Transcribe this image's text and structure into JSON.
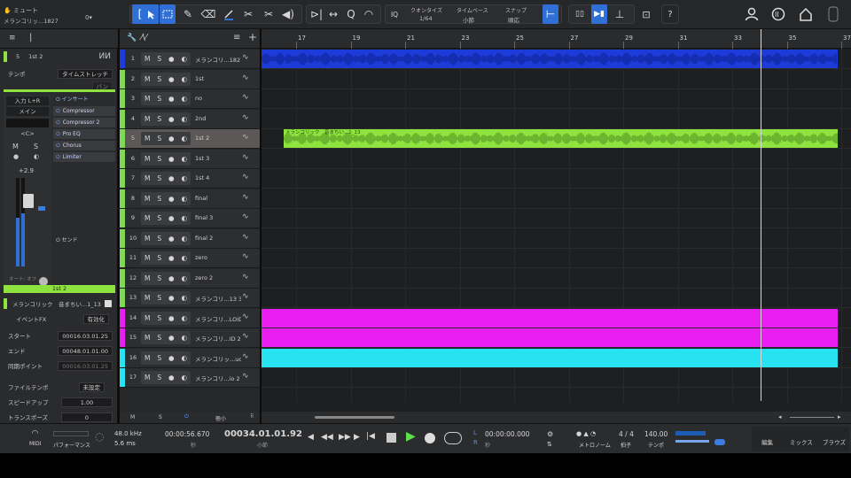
{
  "song": {
    "title": "ミュート",
    "file": "メランコリッ...1827",
    "dropdown": "0▾"
  },
  "toolbar": {
    "quantize_label": "クオンタイズ",
    "quantize_value": "1/64",
    "timebase_label": "タイムベース",
    "timebase_value": "小節",
    "snap_label": "スナップ",
    "snap_value": "順応",
    "iq": "IQ",
    "help": "?"
  },
  "inspector": {
    "track_num": "5",
    "track_name": "1st 2",
    "tempo_label": "テンポ",
    "tempo_value": "タイムストレッチ",
    "tempo2_value": "パン",
    "io_label": "入力 L+R",
    "io_main": "メイン",
    "pan": "<C>",
    "volume": "+2.9",
    "bottom_num": "5",
    "auto": "オート: オフ",
    "inserts_title": "インサート",
    "plugins": [
      "Compressor",
      "Compressor 2",
      "Pro EQ",
      "Chorus",
      "Limiter"
    ],
    "sends_title": "センド",
    "channel_name": "1st 2",
    "event_title": "メランコリック　音まちい...1_13",
    "event_fx": "イベントFX",
    "event_fx_val": "有効化",
    "start_label": "スタート",
    "start_val": "00016.03.01.25",
    "end_label": "エンド",
    "end_val": "00048.01.01.00",
    "sync_label": "同期ポイント",
    "sync_val": "00016.03.01.25",
    "file_tempo_label": "ファイルテンポ",
    "file_tempo_val": "未設定",
    "speed_label": "スピードアップ",
    "speed_val": "1.00",
    "transpose_label": "トランスポーズ",
    "transpose_val": "0"
  },
  "tracks": [
    {
      "num": "1",
      "name": "メランコリ...1827",
      "color": "#1d3bd8"
    },
    {
      "num": "2",
      "name": "1st",
      "color": "#7ed957"
    },
    {
      "num": "3",
      "name": "no",
      "color": "#7ed957"
    },
    {
      "num": "4",
      "name": "2nd",
      "color": "#7ed957"
    },
    {
      "num": "5",
      "name": "1st 2",
      "color": "#7ed957"
    },
    {
      "num": "6",
      "name": "1st 3",
      "color": "#7ed957"
    },
    {
      "num": "7",
      "name": "1st 4",
      "color": "#7ed957"
    },
    {
      "num": "8",
      "name": "final",
      "color": "#7ed957"
    },
    {
      "num": "9",
      "name": "final 3",
      "color": "#7ed957"
    },
    {
      "num": "10",
      "name": "final 2",
      "color": "#7ed957"
    },
    {
      "num": "11",
      "name": "zero",
      "color": "#7ed957"
    },
    {
      "num": "12",
      "name": "zero 2",
      "color": "#7ed957"
    },
    {
      "num": "13",
      "name": "メランコリ...13 3",
      "color": "#7ed957"
    },
    {
      "num": "14",
      "name": "メランコリ...LOID",
      "color": "#e81ff0"
    },
    {
      "num": "15",
      "name": "メランコリ...ID 2",
      "color": "#e81ff0"
    },
    {
      "num": "16",
      "name": "メランコリッ...udio",
      "color": "#27e3f1"
    },
    {
      "num": "17",
      "name": "メランコリ...io 2",
      "color": "#27e3f1"
    }
  ],
  "track_buttons": {
    "m": "M",
    "s": "S",
    "rec": "●",
    "mon": "◐"
  },
  "ruler": [
    "17",
    "19",
    "21",
    "23",
    "25",
    "27",
    "29",
    "31",
    "33",
    "35",
    "37"
  ],
  "clip_labels": {
    "track5": "メランコリック　音まちい...1_13"
  },
  "footer": {
    "m": "M",
    "s": "S",
    "size": "極小"
  },
  "transport": {
    "midi": "MIDI",
    "perf": "パフォーマンス",
    "samplerate": "48.0 kHz",
    "latency": "5.6 ms",
    "time": "00:00:56.670",
    "time_unit": "秒",
    "bars": "00034.01.01.92",
    "bars_unit": "小節",
    "loop_l": "00:00:00.000",
    "loop_unit": "秒",
    "metronome": "メトロノーム",
    "sig": "4 / 4",
    "sig_label": "拍子",
    "tempo": "140.00",
    "tempo_label": "テンポ",
    "tab_edit": "編集",
    "tab_mix": "ミックス",
    "tab_browse": "ブラウズ"
  },
  "colors": {
    "accent": "#2f6fd6",
    "green": "#8ee33f",
    "blue": "#1d3bd8",
    "magenta": "#e81ff0",
    "cyan": "#27e3f1"
  }
}
